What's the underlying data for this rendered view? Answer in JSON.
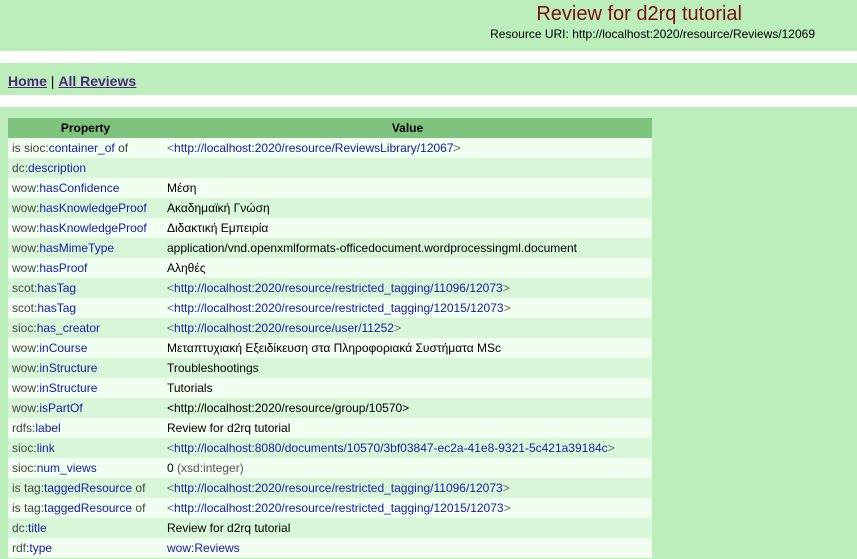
{
  "header": {
    "title": "Review for d2rq tutorial",
    "uri_label": "Resource URI:",
    "uri": "http://localhost:2020/resource/Reviews/12069"
  },
  "nav": {
    "home": "Home",
    "separator": "|",
    "all_reviews": "All Reviews"
  },
  "table": {
    "columns": [
      "Property",
      "Value"
    ],
    "rows": [
      {
        "pre": "is ",
        "prefix": "sioc",
        "local": "container_of",
        "post": " of",
        "value_type": "uri",
        "value": "http://localhost:2020/resource/ReviewsLibrary/12067"
      },
      {
        "pre": "",
        "prefix": "dc",
        "local": "description",
        "post": "",
        "value_type": "literal",
        "value": ""
      },
      {
        "pre": "",
        "prefix": "wow",
        "local": "hasConfidence",
        "post": "",
        "value_type": "literal",
        "value": "Μέση"
      },
      {
        "pre": "",
        "prefix": "wow",
        "local": "hasKnowledgeProof",
        "post": "",
        "value_type": "literal",
        "value": "Ακαδημαϊκή Γνώση"
      },
      {
        "pre": "",
        "prefix": "wow",
        "local": "hasKnowledgeProof",
        "post": "",
        "value_type": "literal",
        "value": "Διδακτική Εμπειρία"
      },
      {
        "pre": "",
        "prefix": "wow",
        "local": "hasMimeType",
        "post": "",
        "value_type": "literal",
        "value": "application/vnd.openxmlformats-officedocument.wordprocessingml.document"
      },
      {
        "pre": "",
        "prefix": "wow",
        "local": "hasProof",
        "post": "",
        "value_type": "literal",
        "value": "Αληθές"
      },
      {
        "pre": "",
        "prefix": "scot",
        "local": "hasTag",
        "post": "",
        "value_type": "uri",
        "value": "http://localhost:2020/resource/restricted_tagging/11096/12073"
      },
      {
        "pre": "",
        "prefix": "scot",
        "local": "hasTag",
        "post": "",
        "value_type": "uri",
        "value": "http://localhost:2020/resource/restricted_tagging/12015/12073"
      },
      {
        "pre": "",
        "prefix": "sioc",
        "local": "has_creator",
        "post": "",
        "value_type": "uri",
        "value": "http://localhost:2020/resource/user/11252"
      },
      {
        "pre": "",
        "prefix": "wow",
        "local": "inCourse",
        "post": "",
        "value_type": "literal",
        "value": "Μεταπτυχιακή Εξειδίκευση στα Πληροφοριακά Συστήματα MSc"
      },
      {
        "pre": "",
        "prefix": "wow",
        "local": "inStructure",
        "post": "",
        "value_type": "literal",
        "value": "Troubleshootings"
      },
      {
        "pre": "",
        "prefix": "wow",
        "local": "inStructure",
        "post": "",
        "value_type": "literal",
        "value": "Tutorials"
      },
      {
        "pre": "",
        "prefix": "wow",
        "local": "isPartOf",
        "post": "",
        "value_type": "literal",
        "value": "<http://localhost:2020/resource/group/10570>"
      },
      {
        "pre": "",
        "prefix": "rdfs",
        "local": "label",
        "post": "",
        "value_type": "literal",
        "value": "Review for d2rq tutorial"
      },
      {
        "pre": "",
        "prefix": "sioc",
        "local": "link",
        "post": "",
        "value_type": "uri",
        "value": "http://localhost:8080/documents/10570/3bf03847-ec2a-41e8-9321-5c421a39184c"
      },
      {
        "pre": "",
        "prefix": "sioc",
        "local": "num_views",
        "post": "",
        "value_type": "typed",
        "value": "0",
        "datatype": " (xsd:integer)"
      },
      {
        "pre": "is ",
        "prefix": "tag",
        "local": "taggedResource",
        "post": " of",
        "value_type": "uri",
        "value": "http://localhost:2020/resource/restricted_tagging/11096/12073"
      },
      {
        "pre": "is ",
        "prefix": "tag",
        "local": "taggedResource",
        "post": " of",
        "value_type": "uri",
        "value": "http://localhost:2020/resource/restricted_tagging/12015/12073"
      },
      {
        "pre": "",
        "prefix": "dc",
        "local": "title",
        "post": "",
        "value_type": "literal",
        "value": "Review for d2rq tutorial"
      },
      {
        "pre": "",
        "prefix": "rdf",
        "local": "type",
        "post": "",
        "value_type": "qname",
        "value": "wow:Reviews"
      }
    ]
  }
}
